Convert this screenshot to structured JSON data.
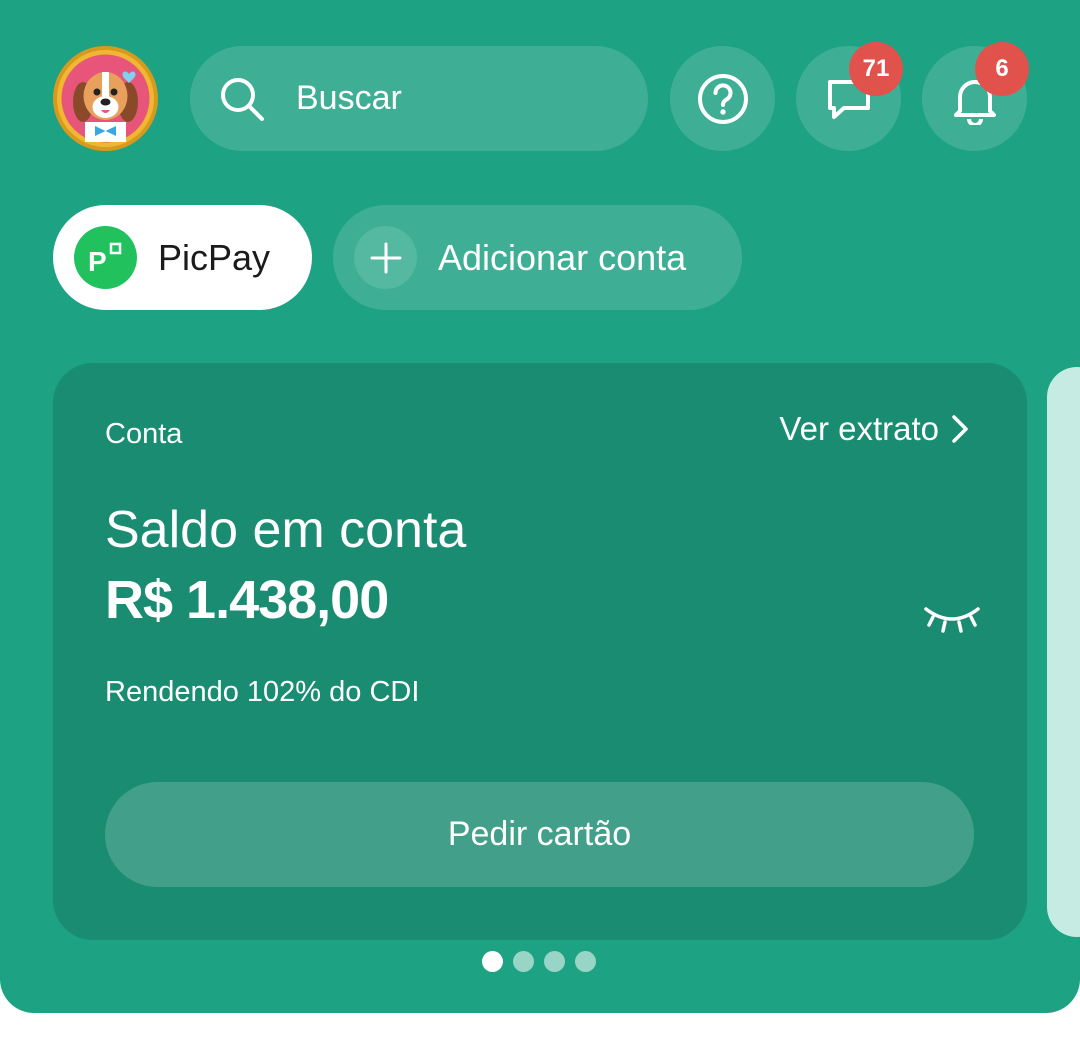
{
  "colors": {
    "brand": "#1da283",
    "card": "#198c71",
    "badge": "#e2524d",
    "picpay_green": "#21c25e"
  },
  "header": {
    "avatar_icon": "profile-avatar-dog",
    "search": {
      "placeholder": "Buscar",
      "icon": "search-icon"
    },
    "help": {
      "icon": "help-circle-icon"
    },
    "messages": {
      "icon": "chat-bubble-icon",
      "badge": "71"
    },
    "notifications": {
      "icon": "bell-icon",
      "badge": "6"
    }
  },
  "accounts": {
    "selected": {
      "label": "PicPay",
      "icon": "picpay-logo-icon"
    },
    "add": {
      "label": "Adicionar conta",
      "icon": "plus-icon"
    }
  },
  "card": {
    "section_label": "Conta",
    "statement_link": "Ver extrato",
    "balance_title": "Saldo em conta",
    "balance_value": "R$ 1.438,00",
    "hide_balance_icon": "eye-closed-icon",
    "yield_text": "Rendendo 102% do CDI",
    "order_card_button": "Pedir cartão"
  },
  "carousel": {
    "pages": 4,
    "active_index": 0
  }
}
